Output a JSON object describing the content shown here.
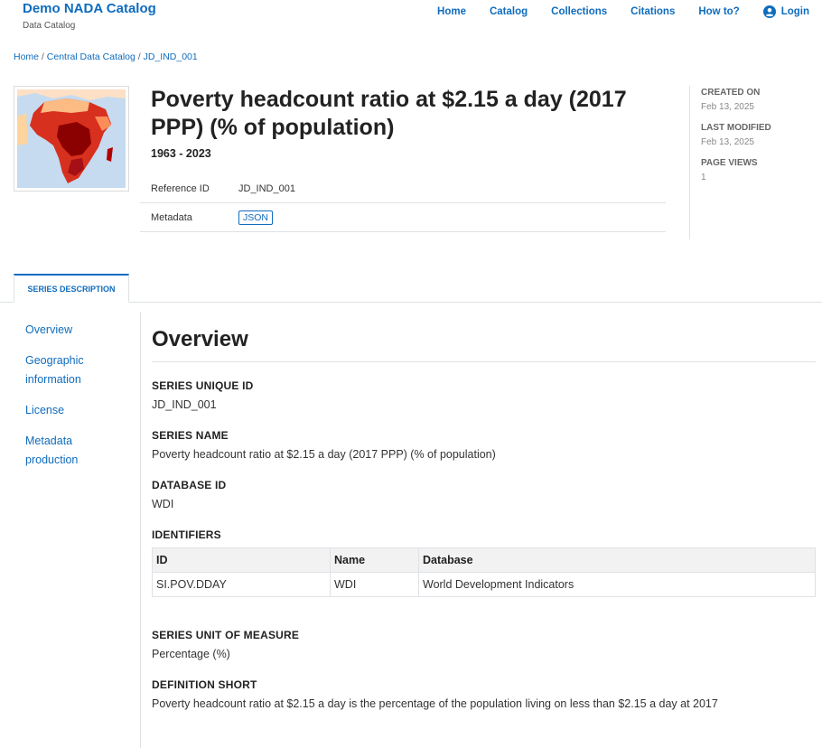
{
  "brand": {
    "title": "Demo NADA Catalog",
    "subtitle": "Data Catalog"
  },
  "nav": {
    "items": [
      "Home",
      "Catalog",
      "Collections",
      "Citations",
      "How to?"
    ],
    "login": "Login"
  },
  "breadcrumb": {
    "home": "Home",
    "catalog": "Central Data Catalog",
    "current": "JD_IND_001",
    "sep": " / "
  },
  "study": {
    "title": "Poverty headcount ratio at $2.15 a day (2017 PPP) (% of population)",
    "years": "1963 - 2023",
    "reference_label": "Reference ID",
    "reference_value": "JD_IND_001",
    "metadata_label": "Metadata",
    "metadata_badge": "JSON"
  },
  "sideinfo": {
    "created_label": "CREATED ON",
    "created_value": "Feb 13, 2025",
    "modified_label": "LAST MODIFIED",
    "modified_value": "Feb 13, 2025",
    "views_label": "PAGE VIEWS",
    "views_value": "1"
  },
  "tabs": {
    "active": "SERIES DESCRIPTION"
  },
  "leftnav": [
    "Overview",
    "Geographic information",
    "License",
    "Metadata production"
  ],
  "overview": {
    "heading": "Overview",
    "unique_id_label": "SERIES UNIQUE ID",
    "unique_id_value": "JD_IND_001",
    "name_label": "SERIES NAME",
    "name_value": "Poverty headcount ratio at $2.15 a day (2017 PPP) (% of population)",
    "database_label": "DATABASE ID",
    "database_value": "WDI",
    "identifiers_label": "IDENTIFIERS",
    "identifiers": {
      "headers": [
        "ID",
        "Name",
        "Database"
      ],
      "rows": [
        [
          "SI.POV.DDAY",
          "WDI",
          "World Development Indicators"
        ]
      ]
    },
    "unit_label": "SERIES UNIT OF MEASURE",
    "unit_value": "Percentage (%)",
    "def_label": "DEFINITION SHORT",
    "def_value": "Poverty headcount ratio at $2.15 a day is the percentage of the population living on less than $2.15 a day at 2017"
  },
  "colors": {
    "link": "#0f6cbd",
    "map_dark": "#8b0000",
    "map_mid": "#d7301f",
    "map_light": "#fdbb84",
    "water": "#c6dbef"
  }
}
